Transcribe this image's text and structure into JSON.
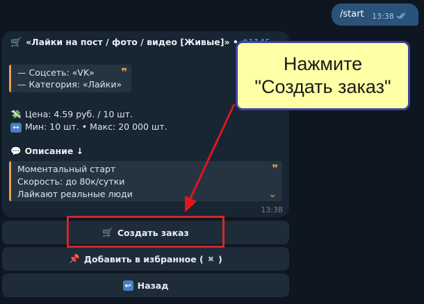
{
  "outgoing": {
    "text": "/start",
    "time": "13:38"
  },
  "message": {
    "header_emoji": "🛒",
    "header_text": "«Лайки на пост / фото / видео [Живые]» •",
    "header_tag": "#1145",
    "quote1": {
      "social": "— Соцсеть: «VK»",
      "category": "— Категория: «Лайки»"
    },
    "price_emoji": "💸",
    "price": "Цена: 4.59 руб. / 10 шт.",
    "range_emoji": "↔",
    "range": "Мин: 10 шт. • Макс: 20 000 шт.",
    "desc_emoji": "💬",
    "desc_title": "Описание ↓",
    "quote2": [
      "Моментальный старт",
      "Скорость: до 80к/сутки",
      "Лайкают реальные люди"
    ],
    "time": "13:38"
  },
  "buttons": {
    "create_emoji": "🛒",
    "create": "Создать заказ",
    "fav_emoji": "📌",
    "fav_pre": "Добавить в избранное (",
    "fav_x": "✖",
    "fav_post": ")",
    "back_emoji": "↩",
    "back": "Назад"
  },
  "callout": {
    "line1": "Нажмите",
    "line2": "\"Создать заказ\""
  },
  "colors": {
    "accent": "#e7a04b",
    "link": "#5ca3e6",
    "highlight": "#d3262a",
    "callout_bg": "#ffffa6"
  }
}
